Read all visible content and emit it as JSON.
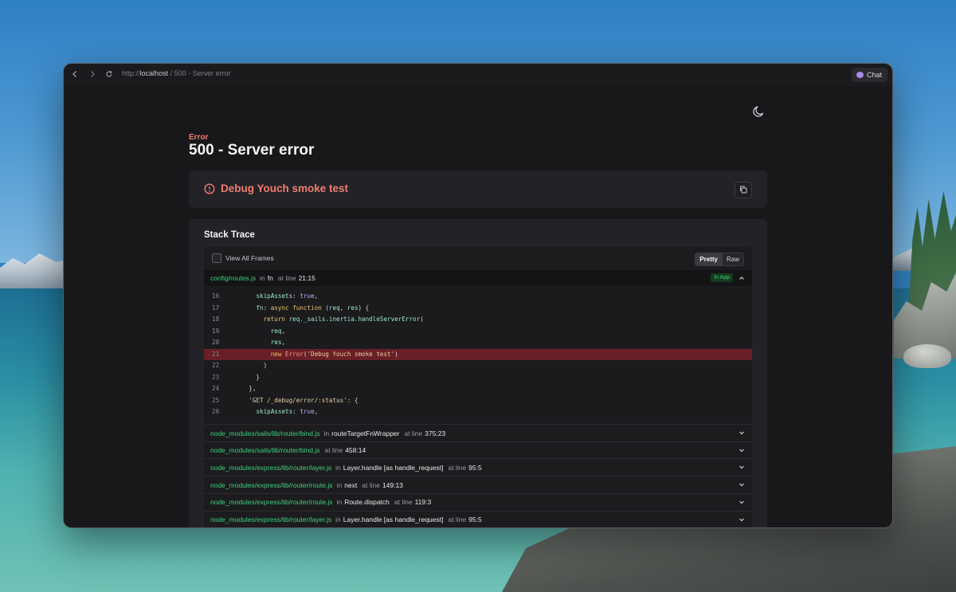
{
  "browser": {
    "url_scheme": "http://",
    "url_host": "localhost",
    "url_path": " / 500 - Server error",
    "chat_label": "Chat"
  },
  "page": {
    "kicker": "Error",
    "title": "500 - Server error",
    "message": "Debug Youch smoke test"
  },
  "trace": {
    "title": "Stack Trace",
    "view_all_frames_label": "View All Frames",
    "mode_pretty": "Pretty",
    "mode_raw": "Raw",
    "in_app_badge": "In App",
    "primary_frame": {
      "file": "config/routes.js",
      "in": "in",
      "fn": "fn",
      "at": "at line",
      "line": "21:15"
    },
    "code_lines": [
      {
        "n": "16",
        "text": "      skipAssets: true,"
      },
      {
        "n": "17",
        "text": "      fn: async function (req, res) {"
      },
      {
        "n": "18",
        "text": "        return req._sails.inertia.handleServerError("
      },
      {
        "n": "19",
        "text": "          req,"
      },
      {
        "n": "20",
        "text": "          res,"
      },
      {
        "n": "21",
        "text": "          new Error('Debug Youch smoke test')"
      },
      {
        "n": "22",
        "text": "        )"
      },
      {
        "n": "23",
        "text": "      }"
      },
      {
        "n": "24",
        "text": "    },"
      },
      {
        "n": "25",
        "text": "    'GET /_debug/error/:status': {"
      },
      {
        "n": "26",
        "text": "      skipAssets: true,"
      }
    ],
    "highlight_line": "21",
    "frames": [
      {
        "file": "node_modules/sails/lib/router/bind.js",
        "in": "in",
        "fn": "routeTargetFnWrapper",
        "at": "at line",
        "line": "375:23"
      },
      {
        "file": "node_modules/sails/lib/router/bind.js",
        "in": "",
        "fn": "",
        "at": "at line",
        "line": "458:14"
      },
      {
        "file": "node_modules/express/lib/router/layer.js",
        "in": "in",
        "fn": "Layer.handle [as handle_request]",
        "at": "at line",
        "line": "95:5"
      },
      {
        "file": "node_modules/express/lib/router/route.js",
        "in": "in",
        "fn": "next",
        "at": "at line",
        "line": "149:13"
      },
      {
        "file": "node_modules/express/lib/router/route.js",
        "in": "in",
        "fn": "Route.dispatch",
        "at": "at line",
        "line": "119:3"
      },
      {
        "file": "node_modules/express/lib/router/layer.js",
        "in": "in",
        "fn": "Layer.handle [as handle_request]",
        "at": "at line",
        "line": "95:5"
      }
    ]
  },
  "colors": {
    "accent_error": "#f17d70",
    "file_green": "#3fcf7a",
    "highlight_bg": "#6a1f27"
  },
  "icons": [
    "back-arrow-icon",
    "forward-arrow-icon",
    "reload-icon",
    "chat-icon",
    "moon-icon",
    "alert-circle-icon",
    "copy-icon",
    "chevron-up-icon",
    "chevron-down-icon"
  ]
}
